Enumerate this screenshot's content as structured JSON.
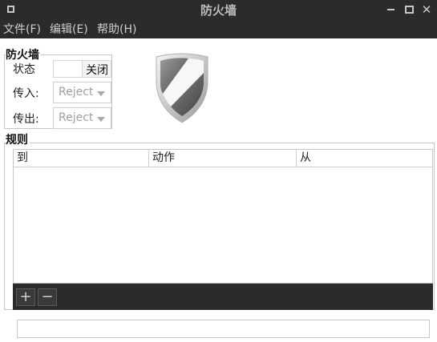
{
  "window": {
    "title": "防火墙",
    "controls": {
      "minimize": "minimize-icon",
      "maximize": "maximize-icon",
      "close": "✕"
    }
  },
  "menubar": {
    "items": [
      {
        "label": "文件(F)"
      },
      {
        "label": "编辑(E)"
      },
      {
        "label": "帮助(H)"
      }
    ]
  },
  "firewall": {
    "section_label": "防火墙",
    "status_label": "状态",
    "status_value": "关闭",
    "incoming_label": "传入:",
    "incoming_value": "Reject",
    "outgoing_label": "传出:",
    "outgoing_value": "Reject",
    "shield_icon": "shield-icon"
  },
  "rules": {
    "section_label": "规则",
    "columns": [
      "到",
      "动作",
      "从"
    ],
    "rows": [],
    "add_label": "+",
    "remove_label": "−"
  },
  "statusbar": {
    "text": ""
  },
  "colors": {
    "titlebar": "#2b2b2b",
    "toolbar": "#2b2b2b",
    "disabled_text": "#a0a0a0"
  }
}
